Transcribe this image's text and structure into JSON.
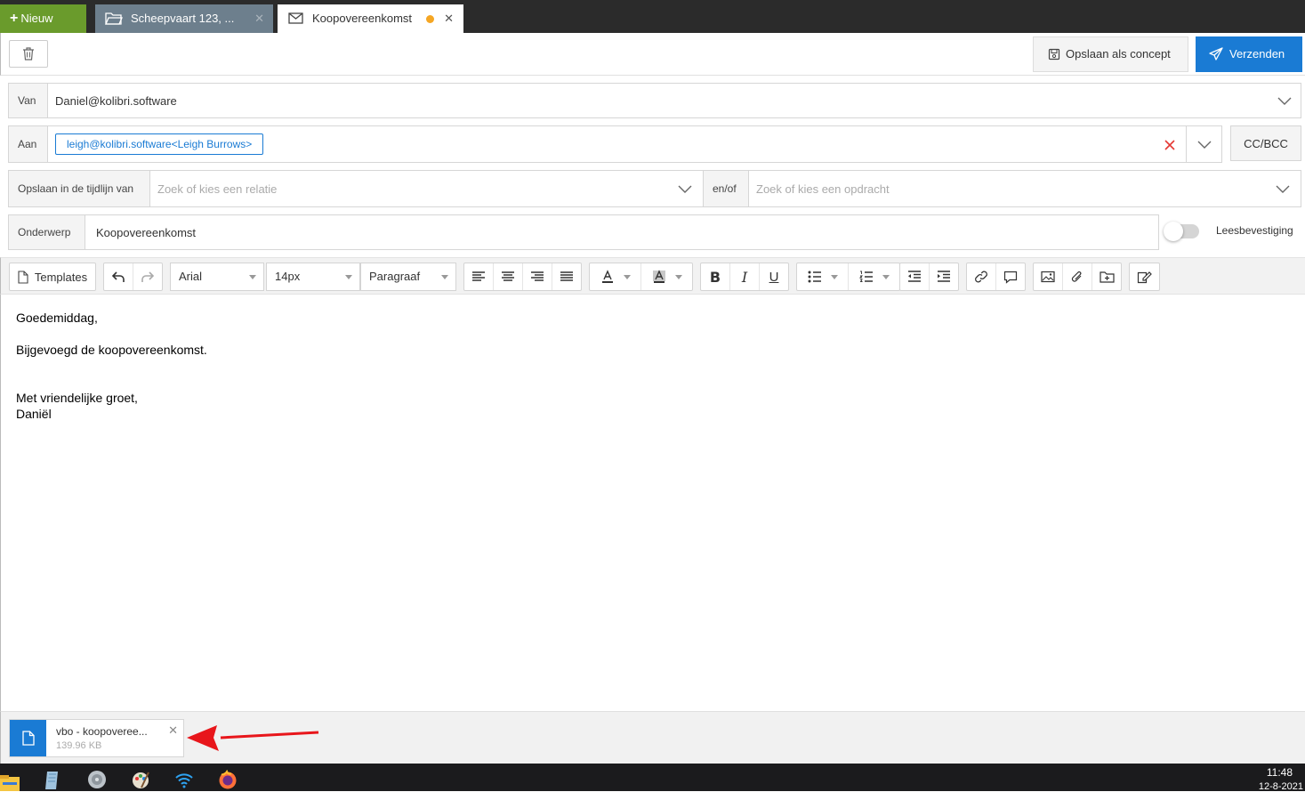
{
  "tabs": {
    "new_label": "Nieuw",
    "new_plus": "+",
    "items": [
      {
        "label": "Scheepvaart 123, ...",
        "icon": "folder-icon",
        "close": "✕"
      },
      {
        "label": "Koopovereenkomst",
        "icon": "envelope-icon",
        "close": "✕",
        "unsaved": true
      }
    ]
  },
  "actions": {
    "draft_label": "Opslaan als concept",
    "send_label": "Verzenden"
  },
  "form": {
    "from": {
      "label": "Van",
      "value": "Daniel@kolibri.software"
    },
    "to": {
      "label": "Aan",
      "chip": "leigh@kolibri.software<Leigh Burrows>",
      "ccbcc": "CC/BCC"
    },
    "timeline": {
      "label": "Opslaan in de tijdlijn van",
      "relation_placeholder": "Zoek of kies een relatie",
      "andor": "en/of",
      "assignment_placeholder": "Zoek of kies een opdracht"
    },
    "subject": {
      "label": "Onderwerp",
      "value": "Koopovereenkomst"
    },
    "read_receipt": {
      "label": "Leesbevestiging",
      "on": false
    }
  },
  "toolbar": {
    "templates_label": "Templates",
    "font": "Arial",
    "size": "14px",
    "block": "Paragraaf"
  },
  "body": {
    "greeting": "Goedemiddag,",
    "line1": "Bijgevoegd de koopovereenkomst.",
    "closing": "Met vriendelijke groet,",
    "signature": "Daniël"
  },
  "attachment": {
    "name": "vbo - koopoveree...",
    "size": "139.96 KB",
    "close": "✕"
  },
  "taskbar": {
    "time": "11:48",
    "date": "12-8-2021"
  },
  "colors": {
    "accent": "#1a7bd4",
    "new_button": "#6a9b2c",
    "unsaved_dot": "#f5a623",
    "remove_x": "#e53935"
  }
}
